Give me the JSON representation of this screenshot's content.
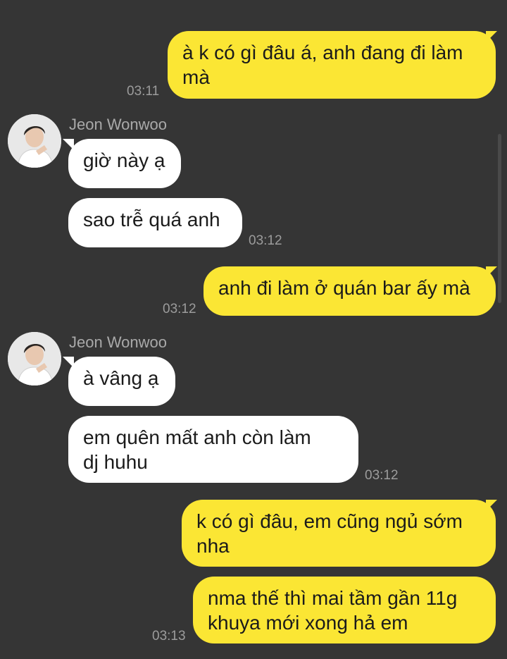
{
  "contact": {
    "name": "Jeon Wonwoo"
  },
  "messages": [
    {
      "from": "me",
      "text": "à k có gì đâu á, anh đang đi làm\nmà",
      "time": "03:11"
    },
    {
      "from": "them",
      "text": "giờ này ạ",
      "time": ""
    },
    {
      "from": "them",
      "text": "sao trễ quá anh",
      "time": "03:12"
    },
    {
      "from": "me",
      "text": "anh đi làm ở quán bar ấy mà",
      "time": "03:12"
    },
    {
      "from": "them",
      "text": "à vâng ạ",
      "time": ""
    },
    {
      "from": "them",
      "text": "em quên mất anh còn làm\ndj huhu",
      "time": "03:12"
    },
    {
      "from": "me",
      "text": "k có gì đâu, em cũng ngủ sớm\nnha",
      "time": ""
    },
    {
      "from": "me",
      "text": "nma thế thì mai tầm gần 11g\nkhuya mới xong hả em",
      "time": "03:13"
    }
  ],
  "colors": {
    "background": "#353535",
    "my_bubble": "#fbe634",
    "their_bubble": "#ffffff",
    "timestamp": "#9c9c9c"
  },
  "icons": {
    "avatar": "contact-avatar-photo"
  }
}
